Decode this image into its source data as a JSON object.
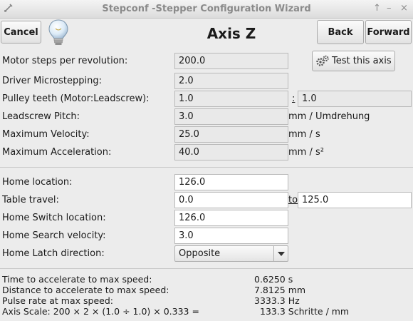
{
  "window": {
    "title": "Stepconf -Stepper Configuration Wizard",
    "controls": [
      "↑",
      "–",
      "×"
    ]
  },
  "toolbar": {
    "cancel_label": "Cancel",
    "heading": "Axis Z",
    "back_label": "Back",
    "forward_label": "Forward"
  },
  "motor": {
    "steps_label": "Motor steps per revolution:",
    "steps_value": "200.0",
    "test_axis_label": "Test this axis",
    "microstepping_label": "Driver Microstepping:",
    "microstepping_value": "2.0",
    "pulley_label": "Pulley teeth (Motor:Leadscrew):",
    "pulley_motor": "1.0",
    "pulley_separator": ":",
    "pulley_leadscrew": "1.0",
    "pitch_label": "Leadscrew Pitch:",
    "pitch_value": "3.0",
    "pitch_unit": "mm / Umdrehung",
    "velocity_label": "Maximum Velocity:",
    "velocity_value": "25.0",
    "velocity_unit": "mm / s",
    "accel_label": "Maximum Acceleration:",
    "accel_value": "40.0",
    "accel_unit": "mm / s²"
  },
  "homing": {
    "home_location_label": "Home location:",
    "home_location_value": "126.0",
    "travel_label": "Table travel:",
    "travel_min": "0.0",
    "travel_to": "to",
    "travel_max": "125.0",
    "switch_label": "Home Switch location:",
    "switch_value": "126.0",
    "search_velocity_label": "Home Search velocity:",
    "search_velocity_value": "3.0",
    "latch_label": "Home Latch direction:",
    "latch_value": "Opposite"
  },
  "info": {
    "rows": [
      {
        "label": "Time to accelerate to max speed:",
        "value": "0.6250 s"
      },
      {
        "label": "Distance to accelerate to max speed:",
        "value": "7.8125 mm"
      },
      {
        "label": "Pulse rate at max speed:",
        "value": "3333.3 Hz"
      },
      {
        "label": "Axis Scale: 200 × 2 × (1.0 ÷ 1.0) × 0.333 =",
        "value": "133.3 Schritte / mm"
      }
    ]
  }
}
